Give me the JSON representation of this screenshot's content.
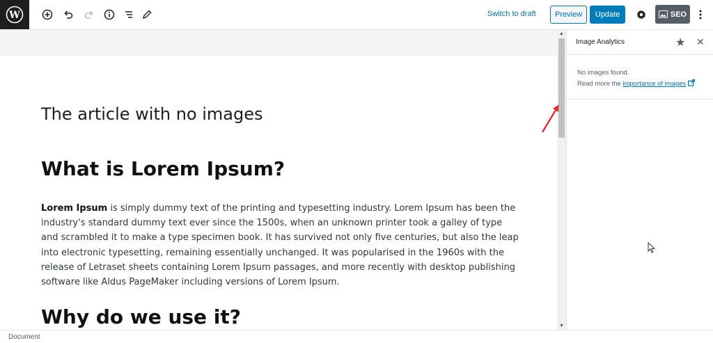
{
  "toolbar": {
    "switch_to_draft": "Switch to draft",
    "preview": "Preview",
    "update": "Update",
    "seo": "SEO"
  },
  "editor": {
    "post_title": "The article with no images",
    "heading_1": "What is Lorem Ipsum?",
    "paragraph_bold": "Lorem Ipsum",
    "paragraph_rest": " is simply dummy text of the printing and typesetting industry. Lorem Ipsum has been the industry's standard dummy text ever since the 1500s, when an unknown printer took a galley of type and scrambled it to make a type specimen book. It has survived not only five centuries, but also the leap into electronic typesetting, remaining essentially unchanged. It was popularised in the 1960s with the release of Letraset sheets containing Lorem Ipsum passages, and more recently with desktop publishing software like Aldus PageMaker including versions of Lorem Ipsum.",
    "heading_2": "Why do we use it?"
  },
  "sidebar": {
    "title": "Image Analytics",
    "no_images": "No images found.",
    "read_more_prefix": "Read more the ",
    "read_more_link": "importance of images"
  },
  "statusbar": {
    "label": "Document"
  },
  "icons": [
    "wordpress-logo",
    "add-block-icon",
    "undo-icon",
    "redo-icon",
    "info-icon",
    "outline-icon",
    "edit-icon",
    "settings-gear-icon",
    "seo-icon",
    "more-options-icon",
    "star-icon",
    "close-icon",
    "external-link-icon"
  ],
  "colors": {
    "accent": "#007cba",
    "link": "#0073aa",
    "dark": "#1e1e1e",
    "annotation_arrow": "#e02d2d"
  }
}
